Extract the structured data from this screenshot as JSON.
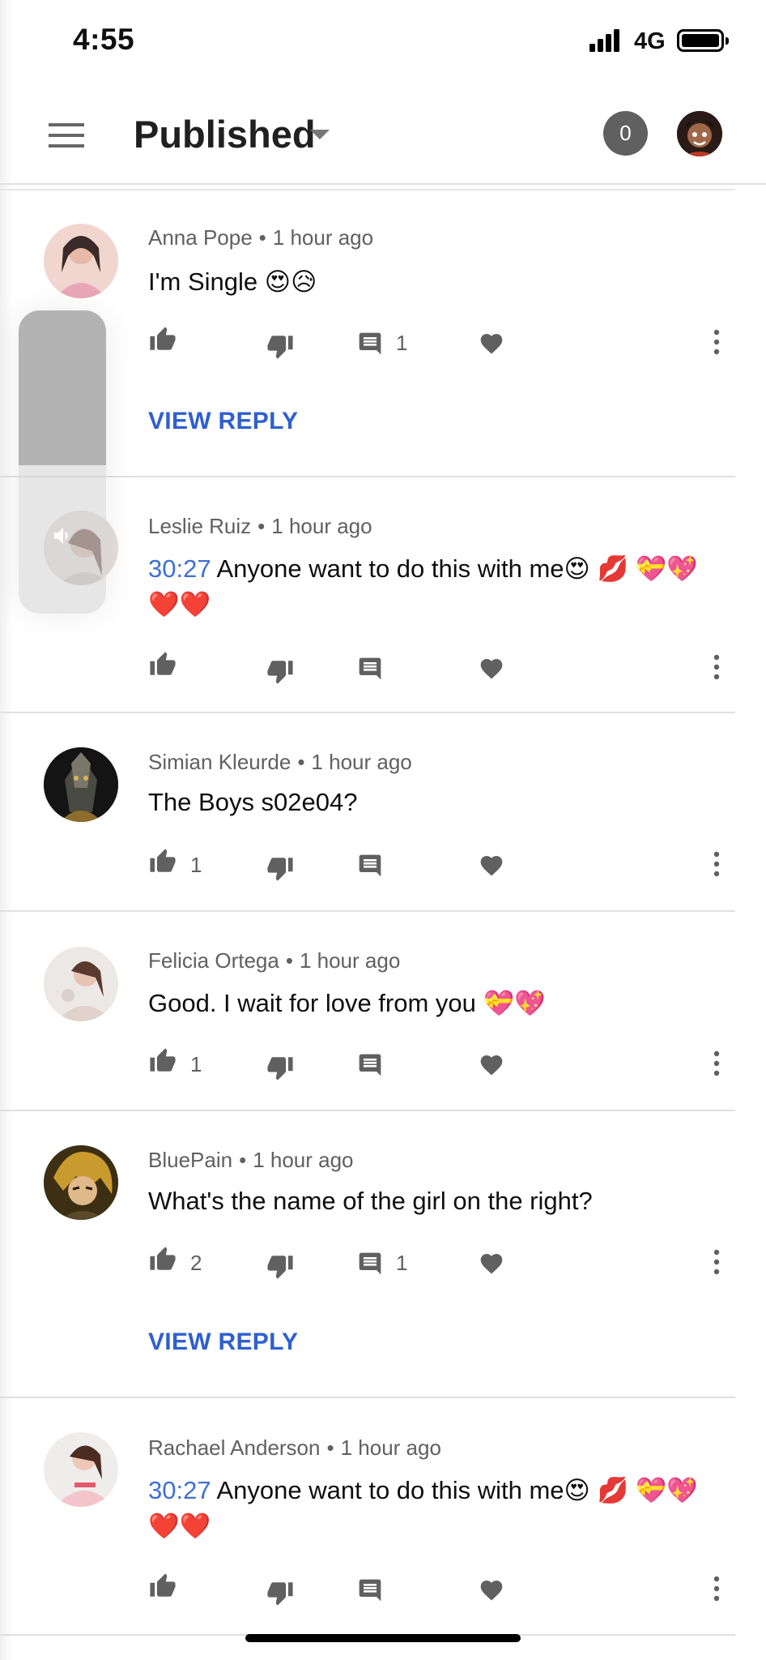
{
  "status_bar": {
    "time": "4:55",
    "network": "4G"
  },
  "header": {
    "title": "Published",
    "notification_count": "0"
  },
  "comments": [
    {
      "author": "Anna Pope",
      "sep": "•",
      "time": "1 hour ago",
      "timestamp": "",
      "text": "I'm Single 😍😥",
      "likes": "",
      "replies": "1",
      "view_reply": "VIEW REPLY"
    },
    {
      "author": "Leslie Ruiz",
      "sep": "•",
      "time": "1 hour ago",
      "timestamp": "30:27",
      "text": "Anyone want to do this with me😍 💋 💝💖❤️❤️",
      "likes": "",
      "replies": "",
      "view_reply": ""
    },
    {
      "author": "Simian Kleurde",
      "sep": "•",
      "time": "1 hour ago",
      "timestamp": "",
      "text": "The Boys s02e04?",
      "likes": "1",
      "replies": "",
      "view_reply": ""
    },
    {
      "author": "Felicia Ortega",
      "sep": "•",
      "time": "1 hour ago",
      "timestamp": "",
      "text": "Good. I wait for love from you 💝💖",
      "likes": "1",
      "replies": "",
      "view_reply": ""
    },
    {
      "author": "BluePain",
      "sep": "•",
      "time": "1 hour ago",
      "timestamp": "",
      "text": "What's the name of the girl on the right?",
      "likes": "2",
      "replies": "1",
      "view_reply": "VIEW REPLY"
    },
    {
      "author": "Rachael Anderson",
      "sep": "•",
      "time": "1 hour ago",
      "timestamp": "30:27",
      "text": "Anyone want to do this with me😍 💋 💝💖❤️❤️",
      "likes": "",
      "replies": "",
      "view_reply": ""
    }
  ],
  "icons": {
    "menu": "menu-icon",
    "dropdown": "caret-down-icon",
    "like": "thumbs-up-icon",
    "dislike": "thumbs-down-icon",
    "reply": "comment-icon",
    "heart": "heart-icon",
    "more": "more-vertical-icon",
    "volume": "speaker-icon"
  },
  "colors": {
    "link": "#3e6fd8",
    "view_reply": "#2f5fcf",
    "icon_gray": "#606060",
    "badge": "#606060"
  },
  "volume_level": 0.51
}
